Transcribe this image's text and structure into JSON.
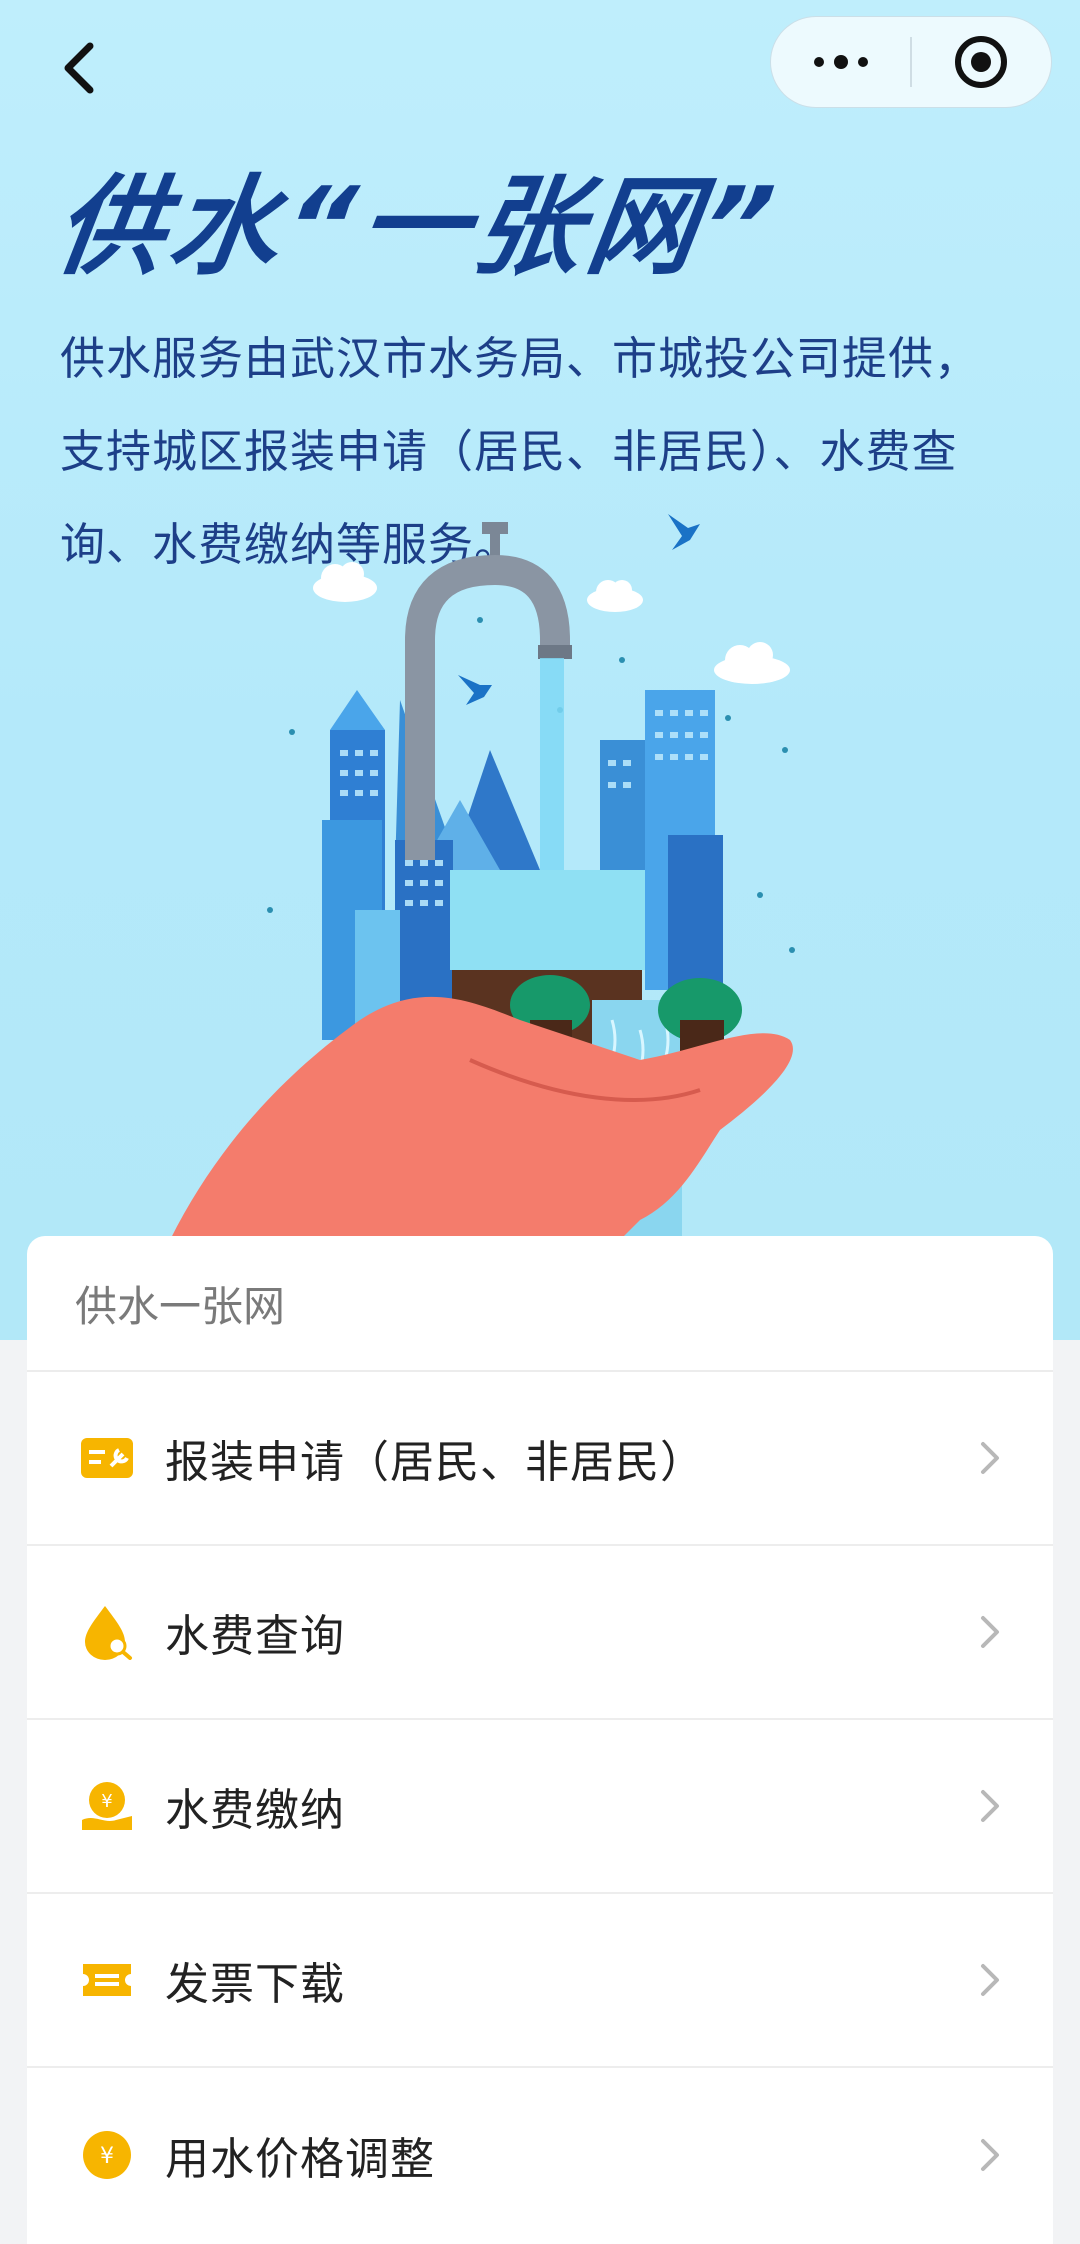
{
  "header": {
    "title": "供水“一张网”",
    "description": "供水服务由武汉市水务局、市城投公司提供，支持城区报装申请（居民、非居民）、水费查询、水费缴纳等服务。"
  },
  "capsule": {
    "more_icon": "more-dots-icon",
    "close_icon": "target-icon"
  },
  "card": {
    "header": "供水一张网",
    "items": [
      {
        "label": "报装申请（居民、非居民）",
        "icon": "tool-card-icon"
      },
      {
        "label": "水费查询",
        "icon": "water-search-icon"
      },
      {
        "label": "水费缴纳",
        "icon": "yen-payment-icon"
      },
      {
        "label": "发票下载",
        "icon": "ticket-icon"
      },
      {
        "label": "用水价格调整",
        "icon": "yen-coin-icon"
      }
    ]
  },
  "colors": {
    "accent": "#f7b500",
    "title": "#123f8f",
    "hero_bg": "#b9ecfb"
  }
}
